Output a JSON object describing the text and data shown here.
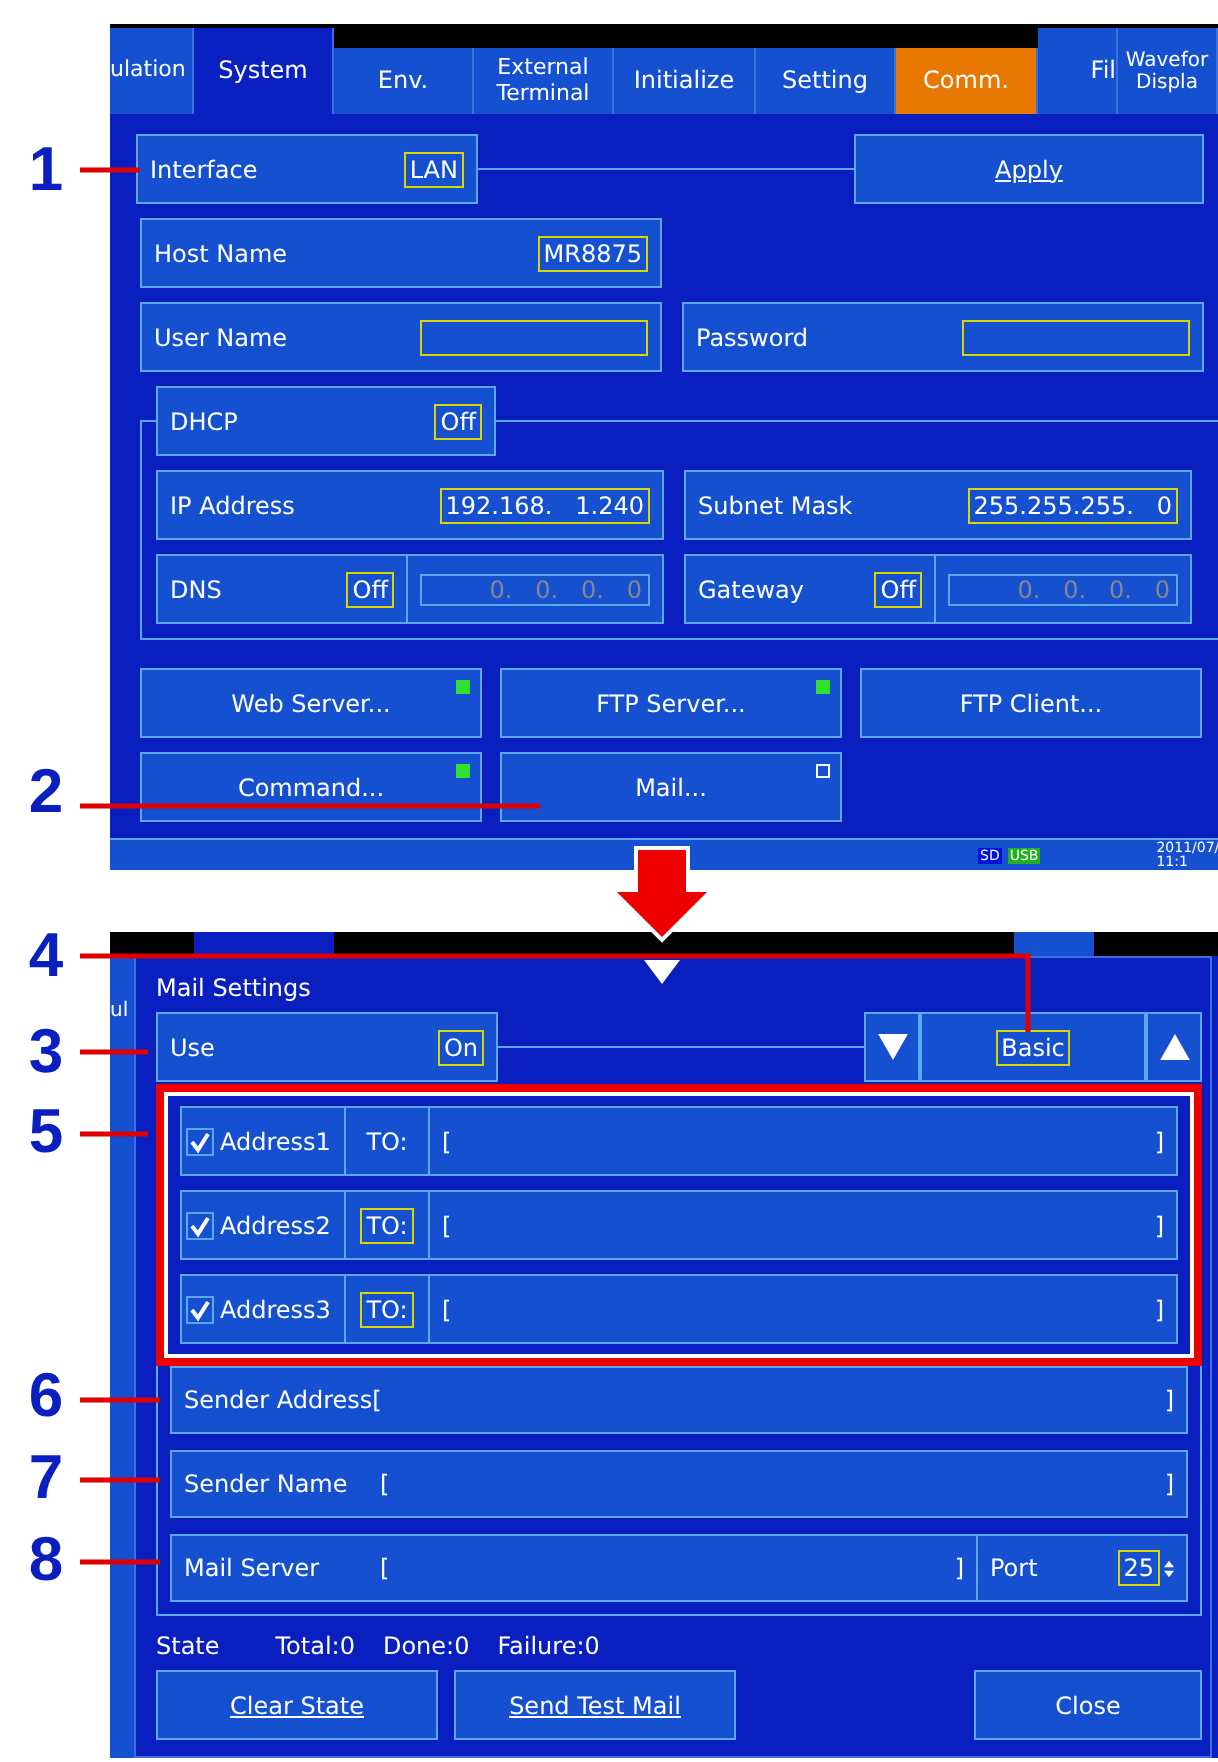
{
  "callouts": [
    {
      "number": "1"
    },
    {
      "number": "2"
    },
    {
      "number": "4"
    },
    {
      "number": "3"
    },
    {
      "number": "5"
    },
    {
      "number": "6"
    },
    {
      "number": "7"
    },
    {
      "number": "8"
    }
  ],
  "top_screen": {
    "tabs": [
      {
        "label": "ulation",
        "kind": "category",
        "selected": false
      },
      {
        "label": "System",
        "kind": "category",
        "selected": true
      },
      {
        "label": "Env.",
        "kind": "page",
        "selected": false
      },
      {
        "label": "External Terminal",
        "kind": "page",
        "selected": false
      },
      {
        "label": "Initialize",
        "kind": "page",
        "selected": false
      },
      {
        "label": "Setting",
        "kind": "page",
        "selected": false
      },
      {
        "label": "Comm.",
        "kind": "page",
        "selected": true
      },
      {
        "label": "Fil",
        "kind": "category",
        "selected": false
      },
      {
        "label": "Wavefor Displa",
        "kind": "category",
        "selected": false
      }
    ],
    "interface": {
      "label": "Interface",
      "value": "LAN"
    },
    "apply": "Apply",
    "host_name": {
      "label": "Host Name",
      "value": "MR8875"
    },
    "user_name": {
      "label": "User Name"
    },
    "password": {
      "label": "Password"
    },
    "dhcp": {
      "label": "DHCP",
      "value": "Off"
    },
    "ip_address": {
      "label": "IP Address",
      "value": "192.168.   1.240"
    },
    "subnet_mask": {
      "label": "Subnet Mask",
      "value": "255.255.255.   0"
    },
    "dns": {
      "label": "DNS",
      "value": "Off",
      "address": "0.   0.   0.   0",
      "disabled": true
    },
    "gateway": {
      "label": "Gateway",
      "value": "Off",
      "address": "0.   0.   0.   0",
      "disabled": true
    },
    "buttons": [
      {
        "label": "Web Server...",
        "kind": "toggle",
        "on": true
      },
      {
        "label": "FTP Server...",
        "kind": "toggle",
        "on": true
      },
      {
        "label": "FTP Client...",
        "kind": "plain"
      },
      {
        "label": "Command...",
        "kind": "toggle",
        "on": true
      },
      {
        "label": "Mail...",
        "kind": "toggle",
        "on": false
      }
    ],
    "status_bar": {
      "sd": "SD",
      "usb": "USB",
      "date": "2011/07/",
      "time": "11:1"
    }
  },
  "mail_settings": {
    "behind_tab": "ul",
    "title": "Mail Settings",
    "use": {
      "label": "Use",
      "value": "On"
    },
    "mode": "Basic",
    "addresses": [
      {
        "label": "Address1",
        "checked": true,
        "type": "TO:",
        "type_boxed": false,
        "open": "[",
        "close": "]"
      },
      {
        "label": "Address2",
        "checked": true,
        "type": "TO:",
        "type_boxed": true,
        "open": "[",
        "close": "]"
      },
      {
        "label": "Address3",
        "checked": true,
        "type": "TO:",
        "type_boxed": true,
        "open": "[",
        "close": "]"
      }
    ],
    "sender_address": {
      "label": "Sender Address[",
      "close": "]"
    },
    "sender_name": {
      "label": "Sender Name",
      "open": "[",
      "close": "]"
    },
    "mail_server": {
      "label": "Mail Server",
      "open": "[",
      "close": "]"
    },
    "port": {
      "label": "Port",
      "value": "25"
    },
    "state": {
      "label": "State",
      "total": "Total:0",
      "done": "Done:0",
      "failure": "Failure:0"
    },
    "buttons": [
      "Clear State",
      "Send Test Mail",
      "Close"
    ]
  }
}
